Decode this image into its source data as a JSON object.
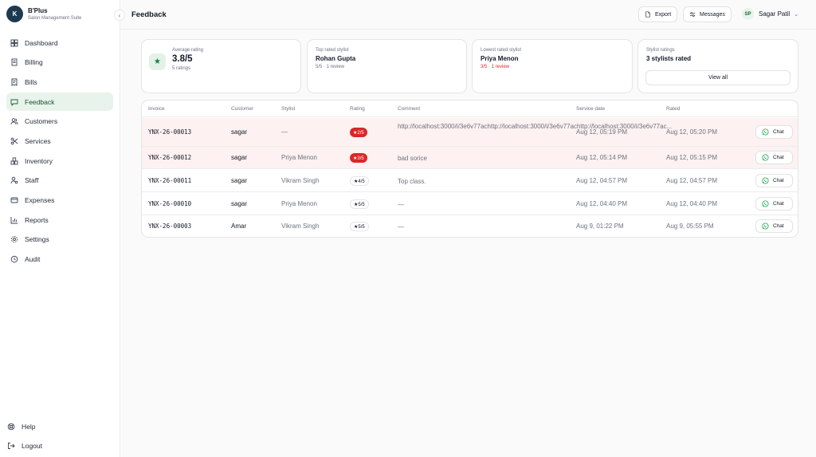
{
  "brand": {
    "logo": "K",
    "name": "B'Plus",
    "subtitle": "Salon Management Suite"
  },
  "sidebar": {
    "collapse_icon": "chevron-left-icon",
    "items": [
      {
        "label": "Dashboard",
        "icon": "dashboard-icon",
        "active": false
      },
      {
        "label": "Billing",
        "icon": "billing-icon",
        "active": false
      },
      {
        "label": "Bills",
        "icon": "bills-icon",
        "active": false
      },
      {
        "label": "Feedback",
        "icon": "feedback-icon",
        "active": true
      },
      {
        "label": "Customers",
        "icon": "customers-icon",
        "active": false
      },
      {
        "label": "Services",
        "icon": "scissors-icon",
        "active": false
      },
      {
        "label": "Inventory",
        "icon": "inventory-icon",
        "active": false
      },
      {
        "label": "Staff",
        "icon": "staff-icon",
        "active": false
      },
      {
        "label": "Expenses",
        "icon": "expenses-icon",
        "active": false
      },
      {
        "label": "Reports",
        "icon": "reports-icon",
        "active": false
      },
      {
        "label": "Settings",
        "icon": "gear-icon",
        "active": false
      },
      {
        "label": "Audit",
        "icon": "audit-icon",
        "active": false
      }
    ],
    "bottom": [
      {
        "label": "Help",
        "icon": "help-icon"
      },
      {
        "label": "Logout",
        "icon": "logout-icon"
      }
    ]
  },
  "header": {
    "title": "Feedback",
    "export_label": "Export",
    "messages_label": "Messages",
    "user_initials": "SP",
    "user_name": "Sagar Patil"
  },
  "stats": {
    "average": {
      "label": "Average rating",
      "value": "3.8/5",
      "sub": "5 ratings"
    },
    "top": {
      "label": "Top rated stylist",
      "value": "Rohan Gupta",
      "sub": "5/5 · 1 review"
    },
    "lowest": {
      "label": "Lowest rated stylist",
      "value": "Priya Menon",
      "sub": "3/5 · 1 review"
    },
    "stylists": {
      "label": "Stylist ratings",
      "value": "3 stylists rated",
      "button": "View all"
    }
  },
  "table": {
    "headers": [
      "Invoice",
      "Customer",
      "Stylist",
      "Rating",
      "Comment",
      "Service date",
      "Rated"
    ],
    "chat_label": "Chat",
    "rows": [
      {
        "invoice": "YNX-26-00013",
        "customer": "sagar",
        "stylist": "—",
        "rating": "★2/5",
        "low": true,
        "comment": "http://localhost:3000/i/3e6v77achttp://localhost:3000/i/3e6v77achttp://localhost:3000/i/3e6v77ac...",
        "service_date": "Aug 12, 05:19 PM",
        "rated": "Aug 12, 05:20 PM"
      },
      {
        "invoice": "YNX-26-00012",
        "customer": "sagar",
        "stylist": "Priya Menon",
        "rating": "★3/5",
        "low": true,
        "comment": "bad sorice",
        "service_date": "Aug 12, 05:14 PM",
        "rated": "Aug 12, 05:15 PM"
      },
      {
        "invoice": "YNX-26-00011",
        "customer": "sagar",
        "stylist": "Vikram Singh",
        "rating": "★4/5",
        "low": false,
        "comment": "Top class.",
        "service_date": "Aug 12, 04:57 PM",
        "rated": "Aug 12, 04:57 PM"
      },
      {
        "invoice": "YNX-26-00010",
        "customer": "sagar",
        "stylist": "Priya Menon",
        "rating": "★5/5",
        "low": false,
        "comment": "—",
        "service_date": "Aug 12, 04:40 PM",
        "rated": "Aug 12, 04:40 PM"
      },
      {
        "invoice": "YNX-26-00003",
        "customer": "Amar",
        "stylist": "Vikram Singh",
        "rating": "★5/5",
        "low": false,
        "comment": "—",
        "service_date": "Aug 9, 01:22 PM",
        "rated": "Aug 9, 05:55 PM"
      }
    ]
  }
}
